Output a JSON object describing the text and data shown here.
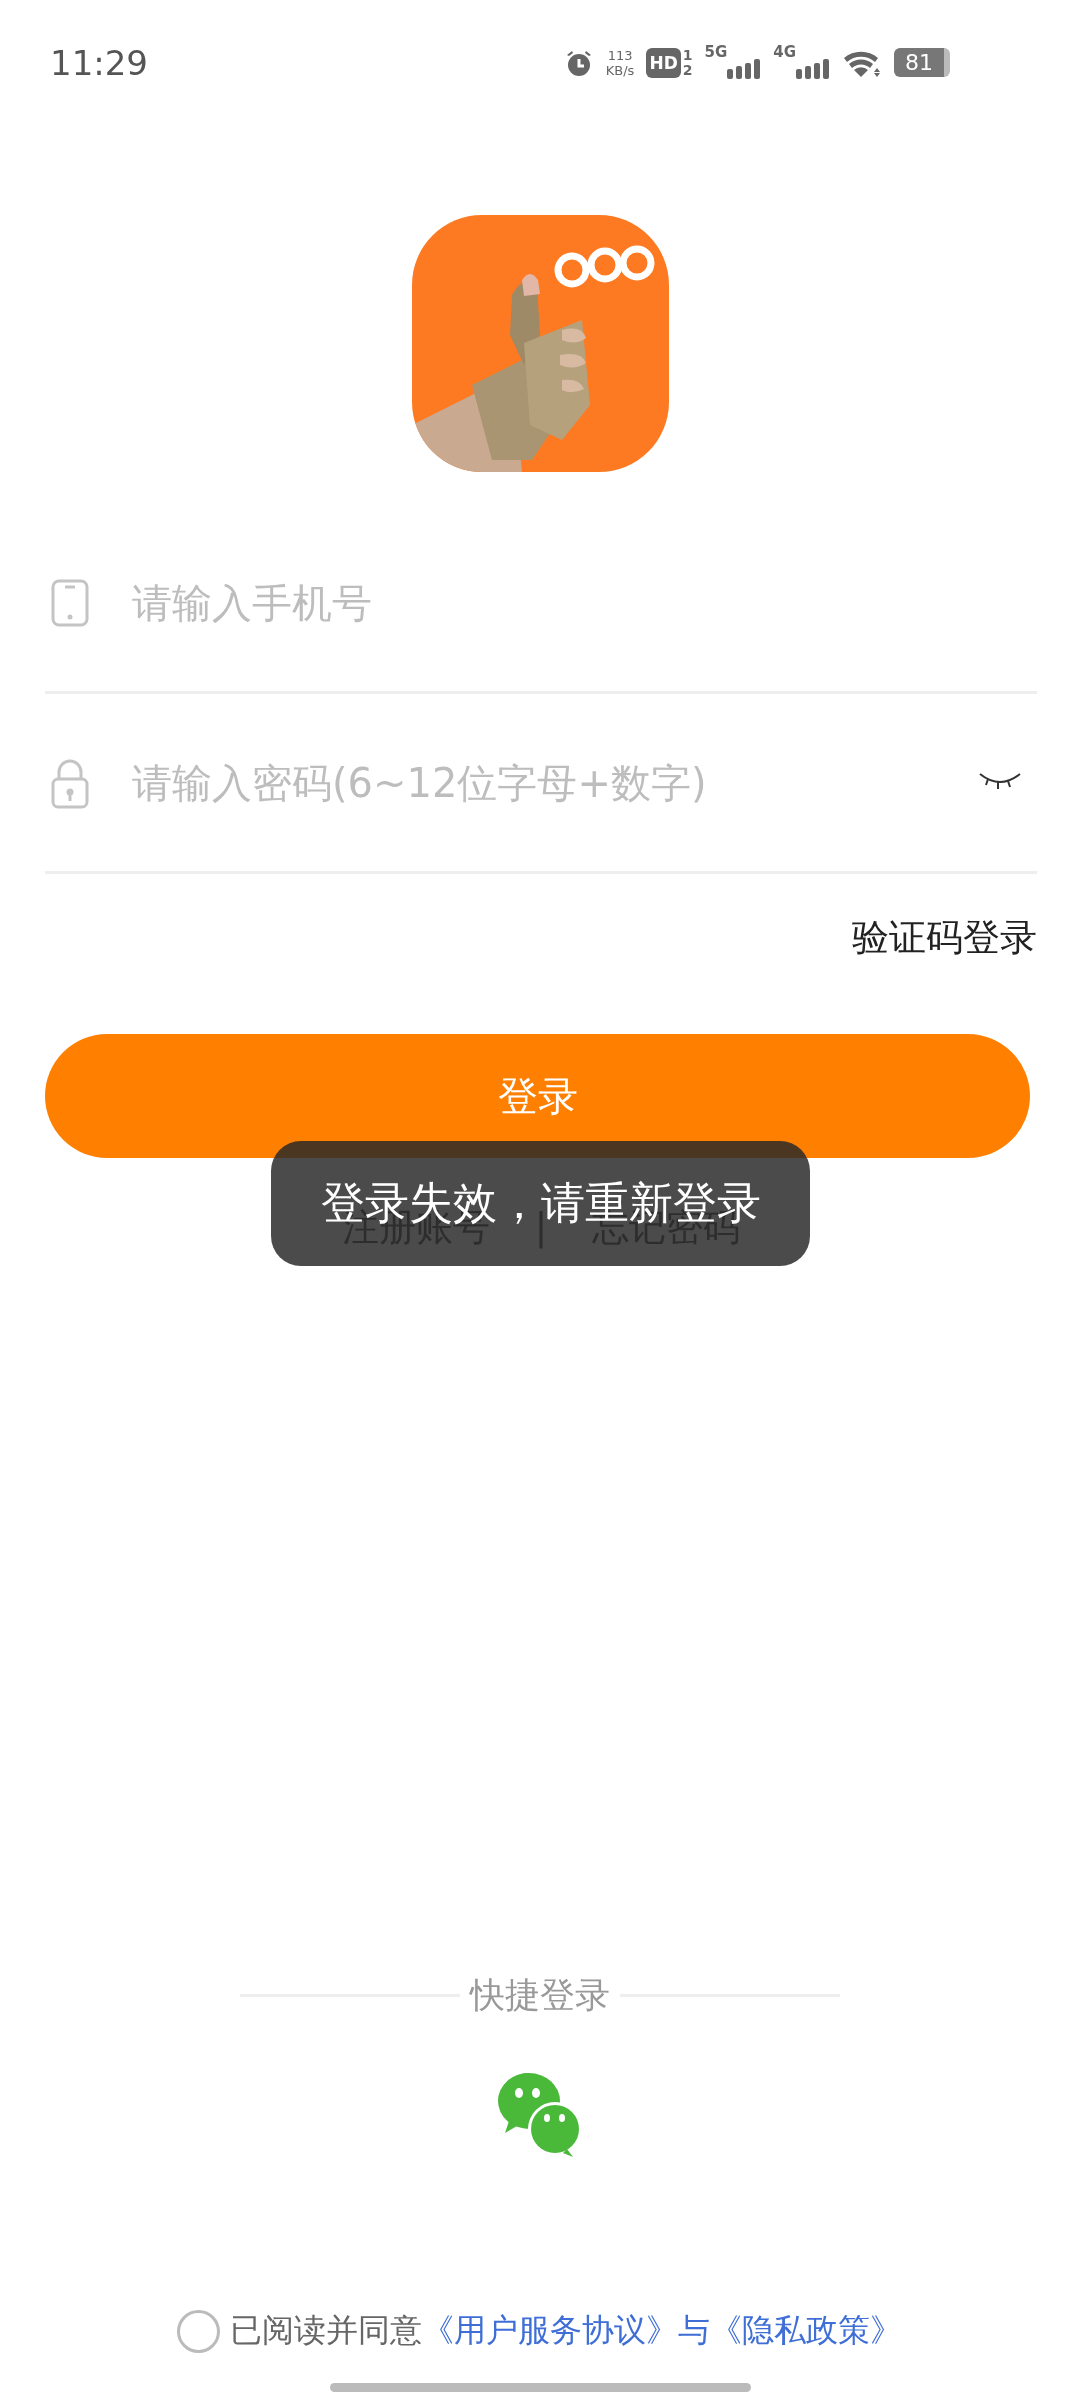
{
  "status_bar": {
    "time": "11:29",
    "net_speed": {
      "value": "113",
      "unit": "KB/s"
    },
    "hd_badge": {
      "label": "HD",
      "sims": [
        "1",
        "2"
      ]
    },
    "signals": [
      {
        "label": "5G"
      },
      {
        "label": "4G"
      }
    ],
    "battery": "81"
  },
  "phone_field": {
    "placeholder": "请输入手机号"
  },
  "password_field": {
    "placeholder": "请输入密码(6~12位字母+数字)",
    "visible": false
  },
  "code_login_link": "验证码登录",
  "login_button": "登录",
  "links": [
    "注册账号",
    "忘记密码"
  ],
  "links_separator": "|",
  "toast": "登录失效，请重新登录",
  "quick_login": {
    "title": "快捷登录"
  },
  "agreement": {
    "checked": false,
    "text": "已阅读并同意",
    "links": [
      "《用户服务协议》",
      "《隐私政策》"
    ],
    "conjunction": "与"
  }
}
